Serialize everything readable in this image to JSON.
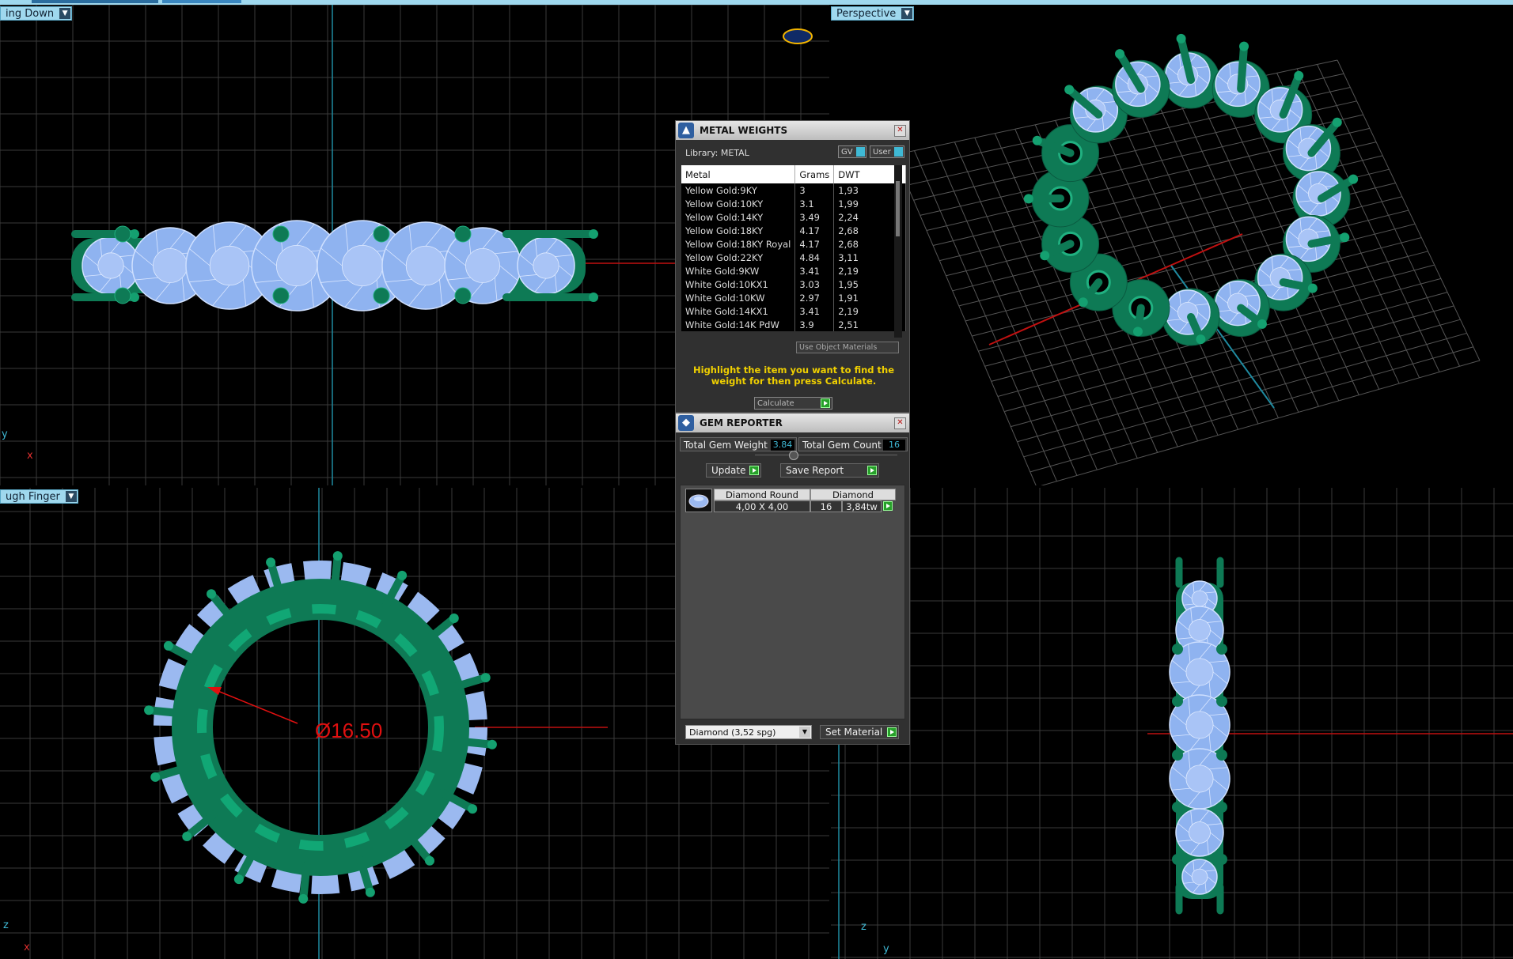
{
  "viewports": {
    "top_left": {
      "label": "ing Down",
      "axis_v": "y",
      "axis_h": "x"
    },
    "top_right": {
      "label": "Perspective"
    },
    "bottom_left": {
      "label": "ugh Finger",
      "axis_v": "z",
      "axis_h": "x",
      "dimension": "Ø16.50"
    },
    "bottom_right": {
      "axis_v": "z",
      "axis_h": "y"
    }
  },
  "metal_weights": {
    "title": "METAL WEIGHTS",
    "library": "Library: METAL",
    "toggle_gv": "GV",
    "toggle_user": "User",
    "columns": [
      "Metal",
      "Grams",
      "DWT"
    ],
    "rows": [
      [
        "Yellow Gold:9KY",
        "3",
        "1,93"
      ],
      [
        "Yellow Gold:10KY",
        "3.1",
        "1,99"
      ],
      [
        "Yellow Gold:14KY",
        "3.49",
        "2,24"
      ],
      [
        "Yellow Gold:18KY",
        "4.17",
        "2,68"
      ],
      [
        "Yellow Gold:18KY Royal",
        "4.17",
        "2,68"
      ],
      [
        "Yellow Gold:22KY",
        "4.84",
        "3,11"
      ],
      [
        "White Gold:9KW",
        "3.41",
        "2,19"
      ],
      [
        "White Gold:10KX1",
        "3.03",
        "1,95"
      ],
      [
        "White Gold:10KW",
        "2.97",
        "1,91"
      ],
      [
        "White Gold:14KX1",
        "3.41",
        "2,19"
      ],
      [
        "White Gold:14K PdW",
        "3.9",
        "2,51"
      ]
    ],
    "use_object_materials": "Use Object Materials",
    "hint": "Highlight the item you want to find the weight for then press Calculate.",
    "calculate": "Calculate"
  },
  "gem_reporter": {
    "title": "GEM REPORTER",
    "total_weight_label": "Total Gem Weight",
    "total_weight_value": "3.84",
    "total_count_label": "Total Gem Count",
    "total_count_value": "16",
    "update": "Update",
    "save_report": "Save Report",
    "gem": {
      "shape": "Diamond Round",
      "material": "Diamond",
      "size": "4,00 X 4,00",
      "count": "16",
      "weight": "3,84tw"
    },
    "material_select": "Diamond     (3,52 spg)",
    "set_material": "Set Material"
  },
  "colors": {
    "metal": "#0e7a55",
    "gem": "#8fb3f0",
    "grid": "#3a3a3a",
    "accent": "#3fb9d5",
    "dimension": "#e01010"
  }
}
